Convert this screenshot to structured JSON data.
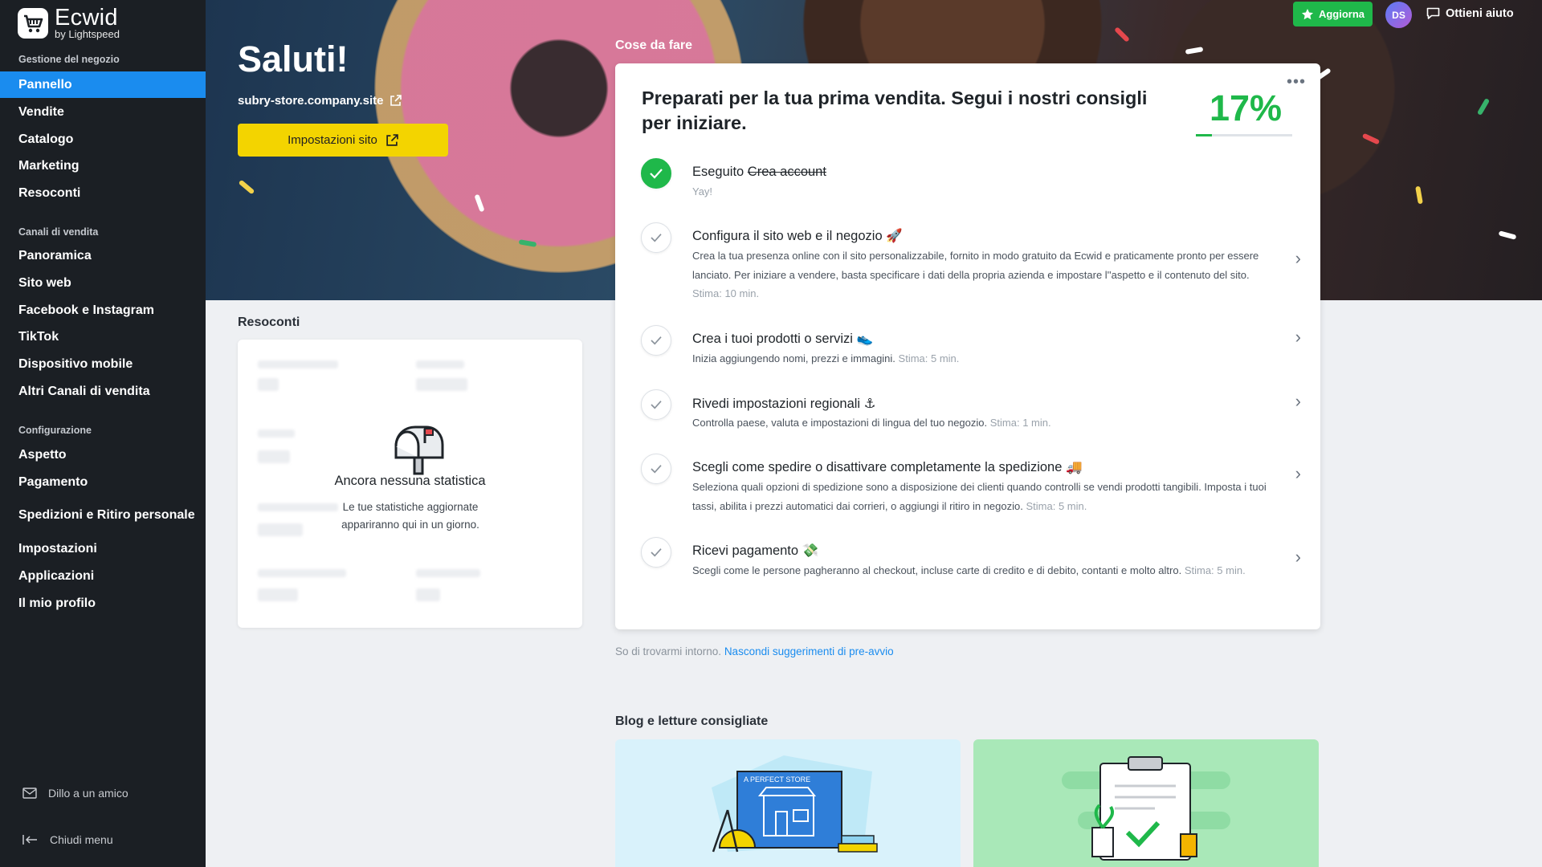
{
  "brand": {
    "name": "Ecwid",
    "sub": "by Lightspeed"
  },
  "sidebar": {
    "section_store": "Gestione del negozio",
    "items_store": [
      {
        "label": "Pannello"
      },
      {
        "label": "Vendite"
      },
      {
        "label": "Catalogo"
      },
      {
        "label": "Marketing"
      },
      {
        "label": "Resoconti"
      }
    ],
    "section_channels": "Canali di vendita",
    "items_channels": [
      {
        "label": "Panoramica"
      },
      {
        "label": "Sito web"
      },
      {
        "label": "Facebook e Instagram"
      },
      {
        "label": "TikTok"
      },
      {
        "label": "Dispositivo mobile"
      },
      {
        "label": "Altri Canali di vendita"
      }
    ],
    "section_config": "Configurazione",
    "items_config": [
      {
        "label": "Aspetto"
      },
      {
        "label": "Pagamento"
      },
      {
        "label": "Spedizioni e Ritiro personale"
      },
      {
        "label": "Impostazioni"
      },
      {
        "label": "Applicazioni"
      },
      {
        "label": "Il mio profilo"
      }
    ],
    "tell_friend": "Dillo a un amico",
    "close_menu": "Chiudi menu"
  },
  "topbar": {
    "upgrade": "Aggiorna",
    "avatar": "DS",
    "help": "Ottieni aiuto"
  },
  "hero": {
    "greeting": "Saluti!",
    "store_url": "subry-store.company.site",
    "site_settings": "Impostazioni sito"
  },
  "todo": {
    "section_title": "Cose da fare",
    "heading": "Preparati per la tua prima vendita. Segui i nostri consigli per iniziare.",
    "percent": "17%",
    "percent_value": 17,
    "more": "•••",
    "tasks": [
      {
        "prefix": "Eseguito ",
        "title": "Crea account",
        "desc": "Yay!",
        "est": ""
      },
      {
        "prefix": "",
        "title": "Configura il sito web e il negozio 🚀",
        "desc": "Crea la tua presenza online con il sito personalizzabile, fornito in modo gratuito da Ecwid e praticamente pronto per essere lanciato. Per iniziare a vendere, basta specificare i dati della propria azienda e impostare l''aspetto e il contenuto del sito.",
        "est": "Stima: 10 min."
      },
      {
        "prefix": "",
        "title": "Crea i tuoi prodotti o servizi 👟",
        "desc": "Inizia aggiungendo nomi, prezzi e immagini.",
        "est": "Stima: 5 min."
      },
      {
        "prefix": "",
        "title": "Rivedi impostazioni regionali ⚓",
        "desc": "Controlla paese, valuta e impostazioni di lingua del tuo negozio.",
        "est": "Stima: 1 min."
      },
      {
        "prefix": "",
        "title": "Scegli come spedire o disattivare completamente la spedizione 🚚",
        "desc": "Seleziona quali opzioni di spedizione sono a disposizione dei clienti quando controlli se vendi prodotti tangibili. Imposta i tuoi tassi, abilita i prezzi automatici dai corrieri, o aggiungi il ritiro in negozio.",
        "est": "Stima: 5 min."
      },
      {
        "prefix": "",
        "title": "Ricevi pagamento 💸",
        "desc": "Scegli come le persone pagheranno al checkout, incluse carte di credito e di debito, contanti e molto altro.",
        "est": "Stima: 5 min."
      }
    ],
    "later_text": "So di trovarmi intorno. ",
    "later_link": "Nascondi suggerimenti di pre-avvio"
  },
  "reports": {
    "title": "Resoconti",
    "empty_title": "Ancora nessuna statistica",
    "empty_desc": "Le tue statistiche aggiornate appariranno qui in un giorno."
  },
  "blog": {
    "title": "Blog e letture consigliate",
    "card1_caption": "A PERFECT STORE"
  },
  "colors": {
    "accent": "#1a8cef",
    "green": "#1fb84a",
    "yellow": "#f3d400",
    "sidebar": "#1b1f24"
  }
}
